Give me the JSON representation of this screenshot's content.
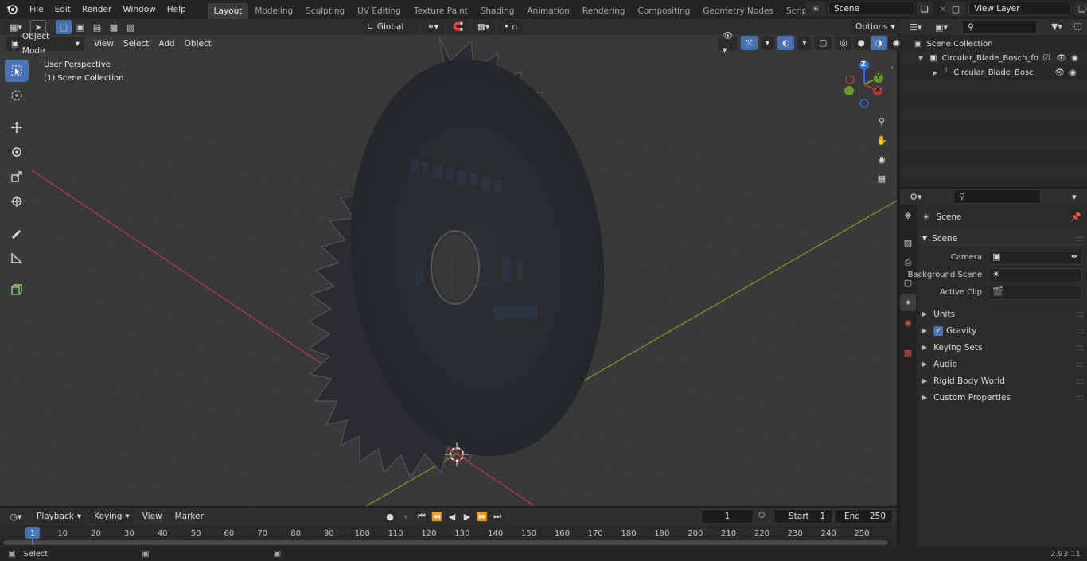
{
  "topbar": {
    "menus": [
      "File",
      "Edit",
      "Render",
      "Window",
      "Help"
    ],
    "workspaces": [
      "Layout",
      "Modeling",
      "Sculpting",
      "UV Editing",
      "Texture Paint",
      "Shading",
      "Animation",
      "Rendering",
      "Compositing",
      "Geometry Nodes",
      "Scripting"
    ],
    "active_workspace": "Layout",
    "scene_name": "Scene",
    "view_layer": "View Layer"
  },
  "viewport": {
    "mode": "Object Mode",
    "menus": [
      "View",
      "Select",
      "Add",
      "Object"
    ],
    "transform_orientation": "Global",
    "options_label": "Options",
    "overlay_title": "User Perspective",
    "overlay_subtitle": "(1) Scene Collection",
    "gizmo_axes": [
      "Z",
      "Y",
      "X"
    ]
  },
  "outliner": {
    "root": "Scene Collection",
    "items": [
      {
        "label": "Circular_Blade_Bosch_for_Wo"
      },
      {
        "label": "Circular_Blade_Bosch_foi"
      }
    ]
  },
  "properties": {
    "header_title": "Scene",
    "panel_title": "Scene",
    "fields": [
      {
        "label": "Camera"
      },
      {
        "label": "Background Scene"
      },
      {
        "label": "Active Clip"
      }
    ],
    "sections": [
      "Units",
      "Gravity",
      "Keying Sets",
      "Audio",
      "Rigid Body World",
      "Custom Properties"
    ],
    "gravity_checked": true
  },
  "timeline": {
    "menus": [
      "Playback",
      "Keying",
      "View",
      "Marker"
    ],
    "current_frame": "1",
    "start_label": "Start",
    "start": "1",
    "end_label": "End",
    "end": "250",
    "ticks": [
      "1",
      "10",
      "20",
      "30",
      "40",
      "50",
      "60",
      "70",
      "80",
      "90",
      "100",
      "110",
      "120",
      "130",
      "140",
      "150",
      "160",
      "170",
      "180",
      "190",
      "200",
      "210",
      "220",
      "230",
      "240",
      "250"
    ]
  },
  "statusbar": {
    "select_label": "Select",
    "version": "2.93.11"
  },
  "colors": {
    "accent": "#4772b3",
    "x_axis": "#b03a44",
    "y_axis": "#6c9a2a",
    "blade": "#2a2c2f"
  }
}
